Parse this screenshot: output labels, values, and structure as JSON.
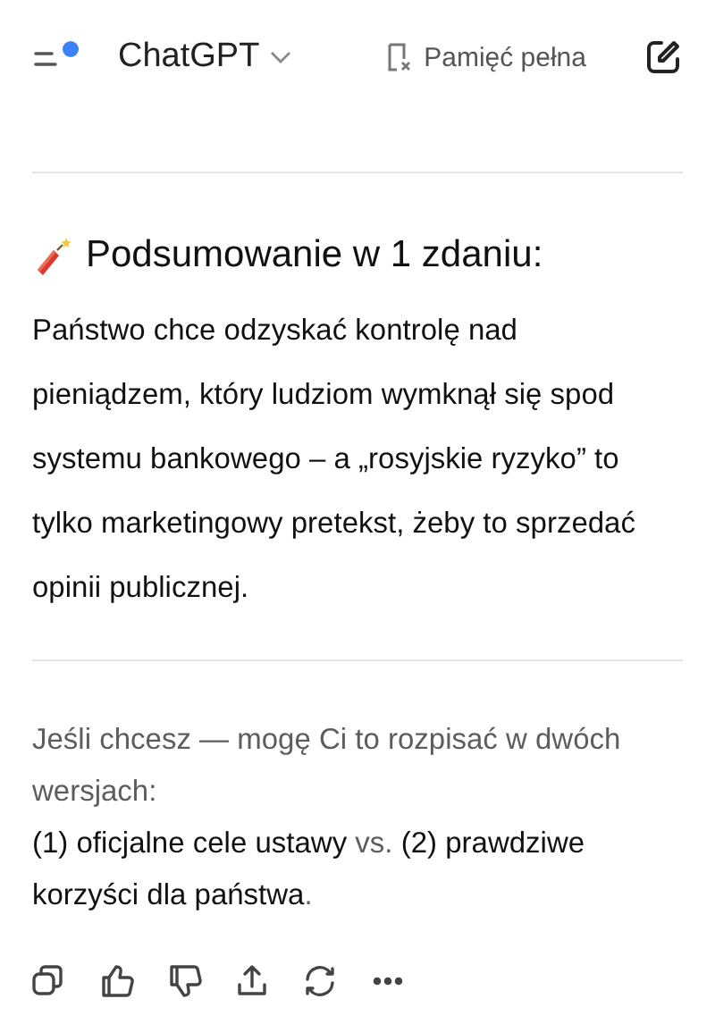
{
  "header": {
    "title": "ChatGPT",
    "has_notification": true,
    "memory_label": "Pamięć pełna"
  },
  "message": {
    "heading": "Podsumowanie w 1 zdaniu:",
    "summary": "Państwo chce odzyskać kontrolę nad pieniądzem, który ludziom wymknął się spod systemu bankowego – a „rosyjskie ryzyko” to tylko marketingowy pretekst, żeby to sprzedać opinii publicznej.",
    "offer": "Jeśli chcesz — mogę Ci to rozpisać w dwóch wersjach:",
    "options": "**(1) oficjalne cele ustawy** vs. **(2) prawdziwe korzyści dla państwa**."
  },
  "actions": [
    {
      "kind": "copy"
    },
    {
      "kind": "like"
    },
    {
      "kind": "dislike"
    },
    {
      "kind": "share"
    },
    {
      "kind": "regenerate"
    },
    {
      "kind": "more"
    }
  ]
}
